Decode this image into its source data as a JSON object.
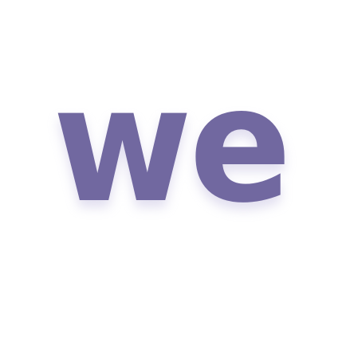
{
  "logo": {
    "text": "we",
    "color": "#7168A0",
    "shadow_color": "#C9C4E3",
    "background": "#FFFFFF"
  }
}
